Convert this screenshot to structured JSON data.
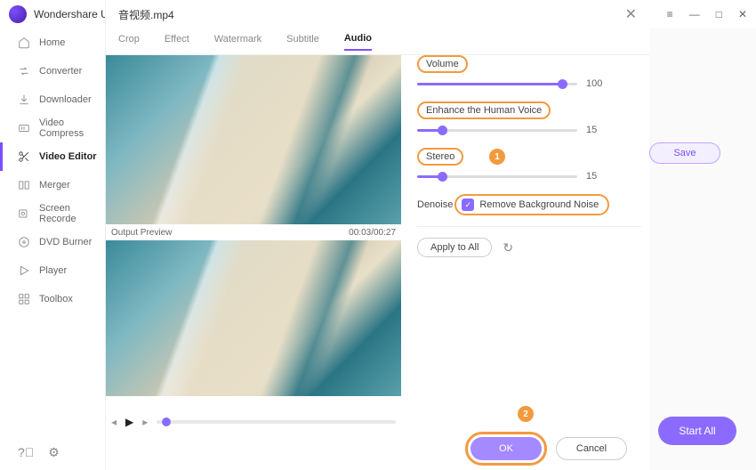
{
  "app": {
    "title": "Wondershare U"
  },
  "sidebar": {
    "items": [
      {
        "label": "Home"
      },
      {
        "label": "Converter"
      },
      {
        "label": "Downloader"
      },
      {
        "label": "Video Compress"
      },
      {
        "label": "Video Editor"
      },
      {
        "label": "Merger"
      },
      {
        "label": "Screen Recorde"
      },
      {
        "label": "DVD Burner"
      },
      {
        "label": "Player"
      },
      {
        "label": "Toolbox"
      }
    ]
  },
  "main": {
    "save": "Save",
    "start_all": "Start All"
  },
  "modal": {
    "title": "音视频.mp4",
    "tabs": [
      "Crop",
      "Effect",
      "Watermark",
      "Subtitle",
      "Audio"
    ],
    "active_tab": "Audio",
    "output_preview_label": "Output Preview",
    "timecode": "00:03/00:27"
  },
  "audio": {
    "volume": {
      "label": "Volume",
      "value": 100
    },
    "enhance": {
      "label": "Enhance the Human Voice",
      "value": 15
    },
    "stereo": {
      "label": "Stereo",
      "value": 15
    },
    "denoise_label": "Denoise",
    "remove_bg": "Remove Background Noise",
    "apply_all": "Apply to All"
  },
  "footer": {
    "ok": "OK",
    "cancel": "Cancel"
  },
  "annotations": {
    "m1": "1",
    "m2": "2"
  }
}
